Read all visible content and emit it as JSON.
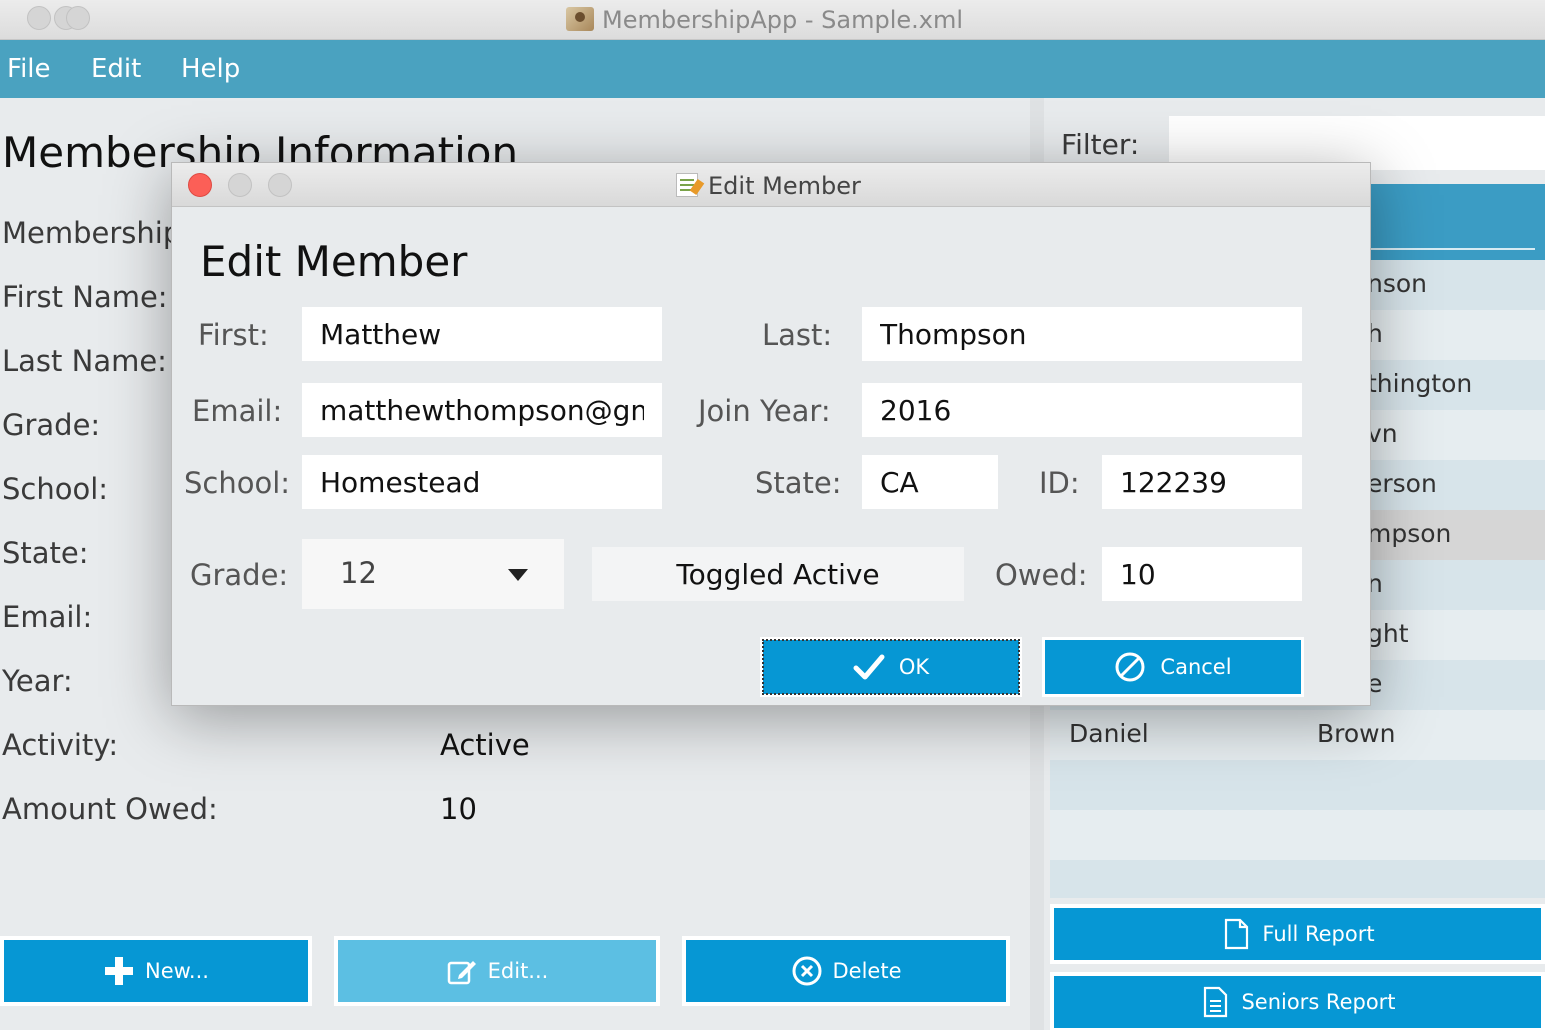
{
  "window": {
    "title": "MembershipApp - Sample.xml"
  },
  "menu": [
    "File",
    "Edit",
    "Help"
  ],
  "details": {
    "title": "Membership Information",
    "labels": [
      "Membership",
      "First Name:",
      "Last Name:",
      "Grade:",
      "School:",
      "State:",
      "Email:",
      "Year:",
      "Activity:",
      "Amount Owed:"
    ],
    "activity_value": "Active",
    "owed_value": "10"
  },
  "filter": {
    "label": "Filter:",
    "value": ""
  },
  "table": {
    "rows": [
      {
        "first": "",
        "last": "nson"
      },
      {
        "first": "",
        "last": "h"
      },
      {
        "first": "",
        "last": "thington"
      },
      {
        "first": "",
        "last": "vn"
      },
      {
        "first": "",
        "last": "erson"
      },
      {
        "first": "",
        "last": "mpson"
      },
      {
        "first": "",
        "last": "n"
      },
      {
        "first": "",
        "last": "ght"
      },
      {
        "first": "",
        "last": "e"
      },
      {
        "first": "Daniel",
        "last": "Brown"
      }
    ]
  },
  "buttons": {
    "new": "New...",
    "edit": "Edit...",
    "delete": "Delete",
    "full_report": "Full Report",
    "seniors_report": "Seniors Report"
  },
  "dialog": {
    "window_title": "Edit Member",
    "heading": "Edit Member",
    "labels": {
      "first": "First:",
      "last": "Last:",
      "email": "Email:",
      "join_year": "Join Year:",
      "school": "School:",
      "state": "State:",
      "id": "ID:",
      "grade": "Grade:",
      "owed": "Owed:"
    },
    "values": {
      "first": "Matthew",
      "last": "Thompson",
      "email": "matthewthompson@gm",
      "join_year": "2016",
      "school": "Homestead",
      "state": "CA",
      "id": "122239",
      "grade": "12",
      "owed": "10"
    },
    "toggle_label": "Toggled Active",
    "ok_label": "OK",
    "cancel_label": "Cancel"
  },
  "colors": {
    "accent": "#0697d4",
    "menubar": "#4aa2c0",
    "selected_row": "#d6d6d6"
  }
}
